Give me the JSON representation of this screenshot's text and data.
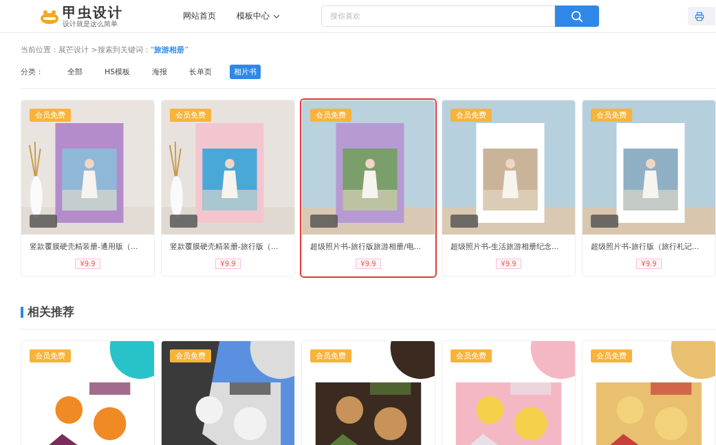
{
  "header": {
    "logo": {
      "name": "甲虫设计",
      "tagline": "设计就是这么简单"
    },
    "nav": [
      {
        "label": "网站首页",
        "dropdown": false
      },
      {
        "label": "模板中心",
        "dropdown": true
      }
    ],
    "search": {
      "placeholder": "搜你喜欢"
    }
  },
  "breadcrumb": {
    "prefix": "当前位置：",
    "site": "展芒设计",
    "middle": " >搜索到关键词：",
    "keyword": "“**旅游相册**”"
  },
  "categories": {
    "label": "分类：",
    "items": [
      {
        "label": "全部",
        "selected": false
      },
      {
        "label": "H5模板",
        "selected": false
      },
      {
        "label": "海报",
        "selected": false
      },
      {
        "label": "长单页",
        "selected": false
      },
      {
        "label": "相片书",
        "selected": true
      }
    ]
  },
  "results": [
    {
      "badge": "会员免费",
      "title": "竖款覆膜硬壳精装册-通用版（...",
      "price": "¥9.9",
      "selected": false
    },
    {
      "badge": "会员免费",
      "title": "竖款覆膜硬壳精装册-旅行版（...",
      "price": "¥9.9",
      "selected": false
    },
    {
      "badge": "会员免费",
      "title": "超级照片书-旅行版旅游相册/电...",
      "price": "¥9.9",
      "selected": true
    },
    {
      "badge": "会员免费",
      "title": "超级照片书-生活旅游相册纪念...",
      "price": "¥9.9",
      "selected": false
    },
    {
      "badge": "会员免费",
      "title": "超级照片书-旅行版（旅行札记...",
      "price": "¥9.9",
      "selected": false
    }
  ],
  "related": {
    "title": "相关推荐",
    "items": [
      {
        "badge": "会员免费"
      },
      {
        "badge": "会员免费"
      },
      {
        "badge": "会员免费"
      },
      {
        "badge": "会员免费"
      },
      {
        "badge": "会员免费"
      }
    ]
  }
}
